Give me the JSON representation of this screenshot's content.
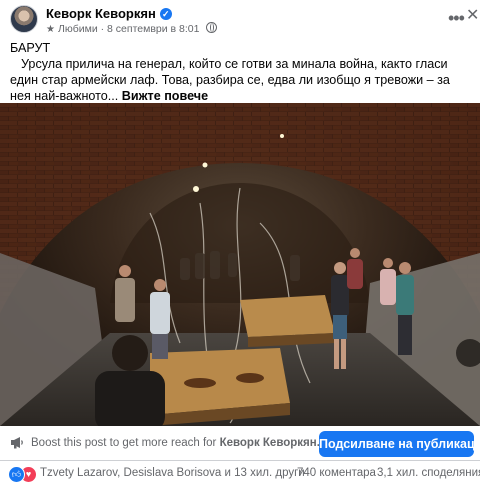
{
  "post": {
    "author": "Кеворк Кеворкян",
    "audience": "Любими",
    "timestamp": "8 септември в 8:01",
    "title": "БАРУТ",
    "body": "Урсула прилича на генерал, който се готви за минала война, както гласи един стар армейски лаф. Това, разбира се, едва ли изобщо я тревожи – за нея най-важното...",
    "see_more": "Вижте повече"
  },
  "boost": {
    "prefix": "Boost this post to get more reach for",
    "page_name": "Кеворк Кеворкян.",
    "button_label": "Подсилване на публикация"
  },
  "stats": {
    "reactors": "Tzvety Lazarov, Desislava Borisova и 13 хил. други",
    "comments": "740 коментара",
    "shares": "3,1 хил. споделяния"
  },
  "icons": {
    "verified": "verified-badge-icon",
    "audience": "star-icon",
    "privacy": "globe-icon",
    "more": "more-options-icon",
    "close": "close-icon",
    "boost": "megaphone-icon",
    "reaction1": "like-icon",
    "reaction2": "love-icon"
  },
  "colors": {
    "accent": "#1877f2",
    "secondary_text": "#65676b",
    "love": "#f33e58"
  }
}
